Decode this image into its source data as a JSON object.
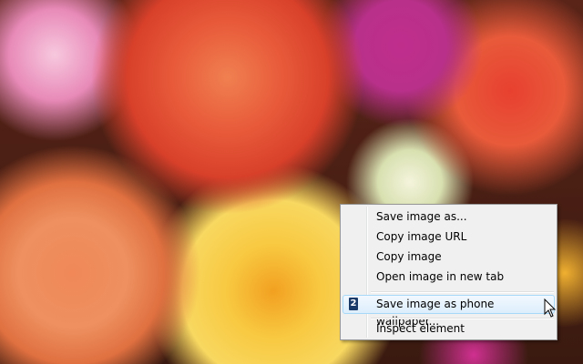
{
  "context_menu": {
    "items": [
      {
        "label": "Save image as..."
      },
      {
        "label": "Copy image URL"
      },
      {
        "label": "Copy image"
      },
      {
        "label": "Open image in new tab"
      },
      {
        "label": "Save image as phone wallpaper...",
        "icon_text": "2",
        "highlighted": true
      },
      {
        "label": "Inspect element"
      }
    ]
  }
}
